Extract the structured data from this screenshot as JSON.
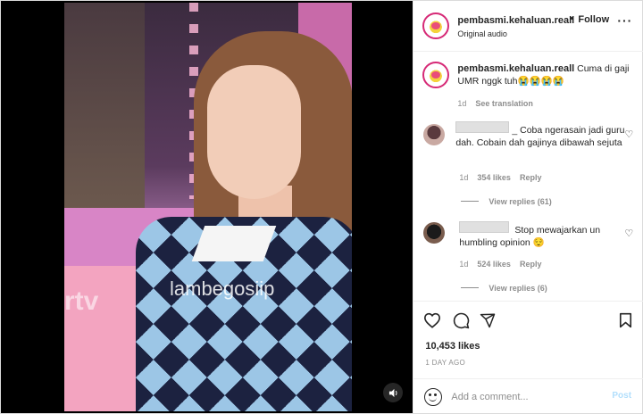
{
  "header": {
    "username": "pembasmi.kehaluan.reall",
    "separator": "•",
    "follow_label": "Follow",
    "audio": "Original audio",
    "more_label": "···"
  },
  "media": {
    "watermark": "lambegosiip",
    "channel_logo": "rtv",
    "mute_icon": "speaker-icon"
  },
  "caption": {
    "username": "pembasmi.kehaluan.reall",
    "text": "Cuma di gaji UMR nggk tuh😭😭😭😭",
    "time": "1d",
    "see_translation": "See translation"
  },
  "comments": [
    {
      "text": "_ Coba ngerasain jadi guru dah. Cobain dah gajinya dibawah sejuta",
      "time": "1d",
      "likes": "354 likes",
      "reply_label": "Reply",
      "view_replies": "View replies (61)"
    },
    {
      "text": "Stop mewajarkan un humbling opinion 😌",
      "time": "1d",
      "likes": "524 likes",
      "reply_label": "Reply",
      "view_replies": "View replies (6)"
    }
  ],
  "actions": {
    "likes": "10,453 likes",
    "date": "1 DAY AGO"
  },
  "comment_box": {
    "placeholder": "Add a comment...",
    "post_label": "Post"
  },
  "colors": {
    "link_blue_disabled": "#b2dffc",
    "muted_text": "#8e8e8e",
    "border": "#efefef"
  }
}
